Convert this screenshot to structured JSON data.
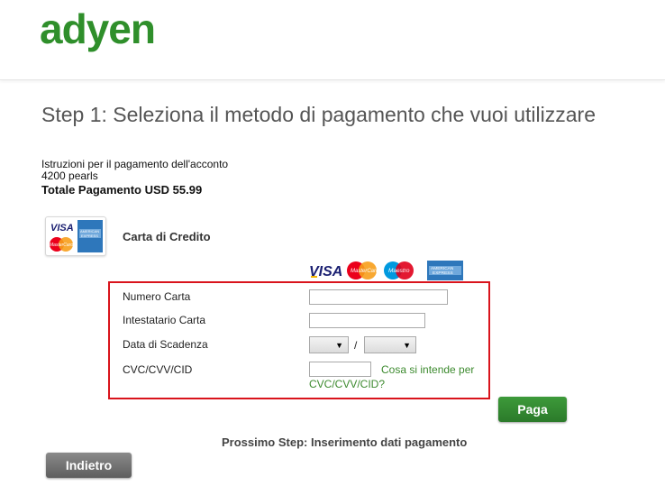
{
  "header": {
    "logo_text": "adyen"
  },
  "step_title": "Step 1: Seleziona il metodo di pagamento che vuoi utilizzare",
  "instructions": {
    "line1": "Istruzioni per il pagamento dell'acconto",
    "line2": "4200 pearls",
    "total": "Totale Pagamento USD 55.99"
  },
  "payment_method": {
    "label": "Carta di Credito",
    "brands": [
      "VISA",
      "MasterCard",
      "Maestro",
      "American Express"
    ]
  },
  "form": {
    "card_number_label": "Numero Carta",
    "card_number_value": "",
    "holder_label": "Intestatario Carta",
    "holder_value": "",
    "expiry_label": "Data di Scadenza",
    "expiry_month": "",
    "expiry_sep": "/",
    "expiry_year": "",
    "cvc_label": "CVC/CVV/CID",
    "cvc_value": "",
    "cvc_help_1": "Cosa si intende per",
    "cvc_help_2": "CVC/CVV/CID?"
  },
  "buttons": {
    "pay": "Paga",
    "back": "Indietro"
  },
  "next_step": "Prossimo Step: Inserimento dati pagamento",
  "colors": {
    "brand_green": "#3c8a2e",
    "form_border": "#d9141c"
  }
}
